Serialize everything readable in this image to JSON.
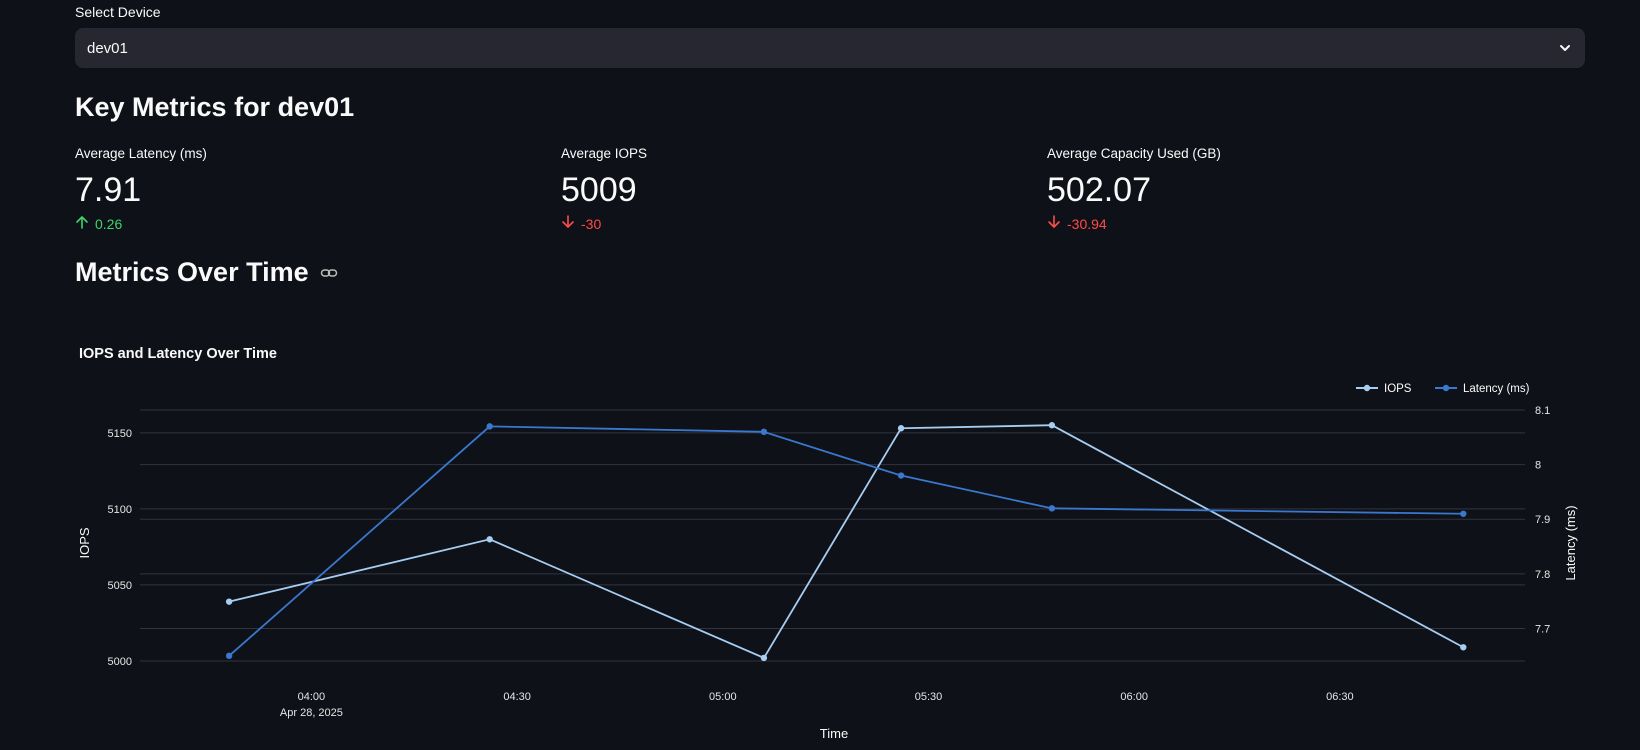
{
  "device_selector": {
    "label": "Select Device",
    "value": "dev01",
    "chevron_icon": "chevron-down-icon"
  },
  "key_metrics": {
    "heading": "Key Metrics for dev01",
    "items": [
      {
        "label": "Average Latency (ms)",
        "value": "7.91",
        "delta": "0.26",
        "direction": "up",
        "delta_icon": "arrow-up-icon",
        "color": "#3dd56d"
      },
      {
        "label": "Average IOPS",
        "value": "5009",
        "delta": "-30",
        "direction": "down",
        "delta_icon": "arrow-down-icon",
        "color": "#ff4b4b"
      },
      {
        "label": "Average Capacity Used (GB)",
        "value": "502.07",
        "delta": "-30.94",
        "direction": "down",
        "delta_icon": "arrow-down-icon",
        "color": "#ff4b4b"
      }
    ]
  },
  "metrics_over_time": {
    "heading": "Metrics Over Time",
    "link_icon": "link-icon"
  },
  "chart_data": {
    "type": "line",
    "title": "IOPS and Latency Over Time",
    "xlabel": "Time",
    "ylabel": "IOPS",
    "y2label": "Latency (ms)",
    "x_ticks": [
      {
        "label": "04:00",
        "sub": "Apr 28, 2025",
        "t": "2025-04-28 04:00"
      },
      {
        "label": "04:30",
        "sub": "",
        "t": "2025-04-28 04:30"
      },
      {
        "label": "05:00",
        "sub": "",
        "t": "2025-04-28 05:00"
      },
      {
        "label": "05:30",
        "sub": "",
        "t": "2025-04-28 05:30"
      },
      {
        "label": "06:00",
        "sub": "",
        "t": "2025-04-28 06:00"
      },
      {
        "label": "06:30",
        "sub": "",
        "t": "2025-04-28 06:30"
      }
    ],
    "xlim": [
      "2025-04-28 03:35",
      "2025-04-28 06:57"
    ],
    "x": [
      "2025-04-28 03:48",
      "2025-04-28 04:26",
      "2025-04-28 05:06",
      "2025-04-28 05:26",
      "2025-04-28 05:48",
      "2025-04-28 06:48"
    ],
    "series": [
      {
        "name": "IOPS",
        "axis": "left",
        "color": "#a6cdf2",
        "values": [
          5039,
          5080,
          5002,
          5153,
          5155,
          5009
        ]
      },
      {
        "name": "Latency (ms)",
        "axis": "right",
        "color": "#3a78d0",
        "values": [
          7.65,
          8.07,
          8.06,
          7.98,
          7.92,
          7.91
        ]
      }
    ],
    "y_ticks": [
      5000,
      5050,
      5100,
      5150
    ],
    "y2_ticks": [
      7.7,
      7.8,
      7.9,
      8,
      8.1
    ],
    "ylim": [
      4998,
      5165
    ],
    "y2lim": [
      7.635,
      8.1
    ],
    "grid": true,
    "legend": "top-right"
  }
}
